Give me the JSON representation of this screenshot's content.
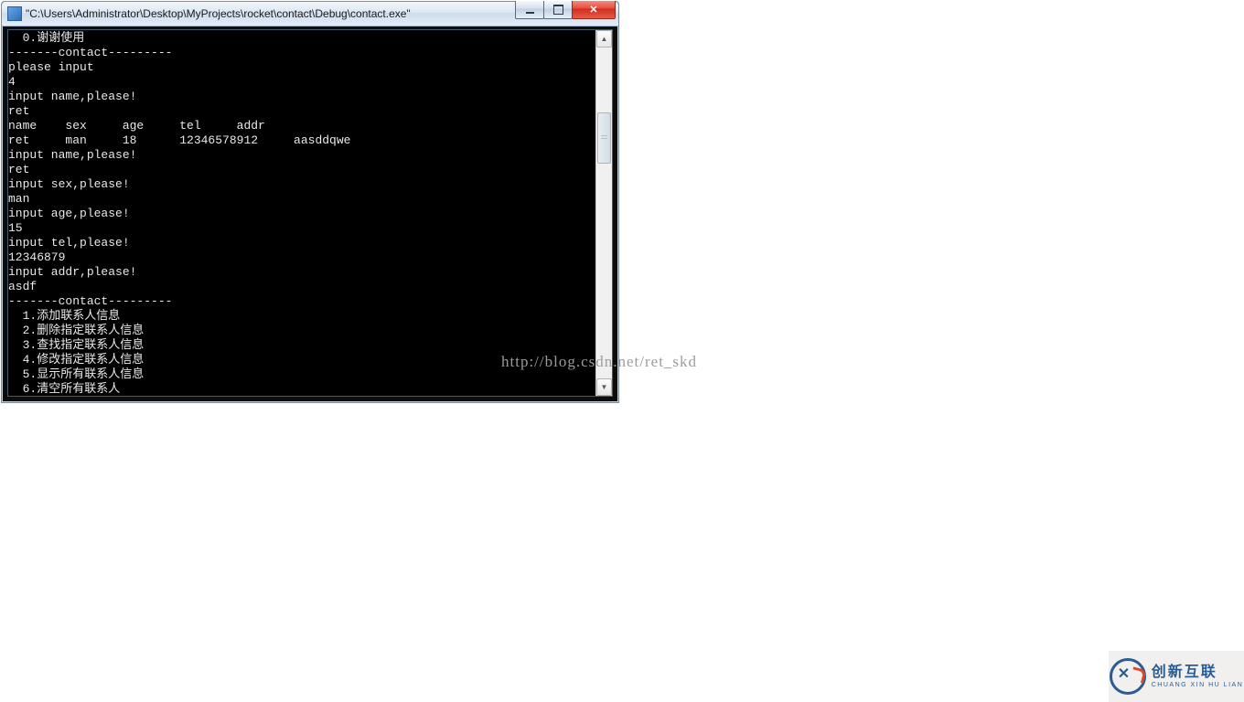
{
  "window": {
    "title": "\"C:\\Users\\Administrator\\Desktop\\MyProjects\\rocket\\contact\\Debug\\contact.exe\""
  },
  "console": {
    "lines": [
      "  0.谢谢使用",
      "-------contact---------",
      "please input",
      "4",
      "input name,please!",
      "ret",
      "name    sex     age     tel     addr",
      "ret     man     18      12346578912     aasddqwe",
      "input name,please!",
      "ret",
      "input sex,please!",
      "man",
      "input age,please!",
      "15",
      "input tel,please!",
      "12346879",
      "input addr,please!",
      "asdf",
      "-------contact---------",
      "  1.添加联系人信息",
      "  2.删除指定联系人信息",
      "  3.查找指定联系人信息",
      "  4.修改指定联系人信息",
      "  5.显示所有联系人信息",
      "  6.清空所有联系人"
    ]
  },
  "watermark": "http://blog.csdn.net/ret_skd",
  "logo": {
    "cn": "创新互联",
    "en": "CHUANG XIN HU LIAN"
  }
}
